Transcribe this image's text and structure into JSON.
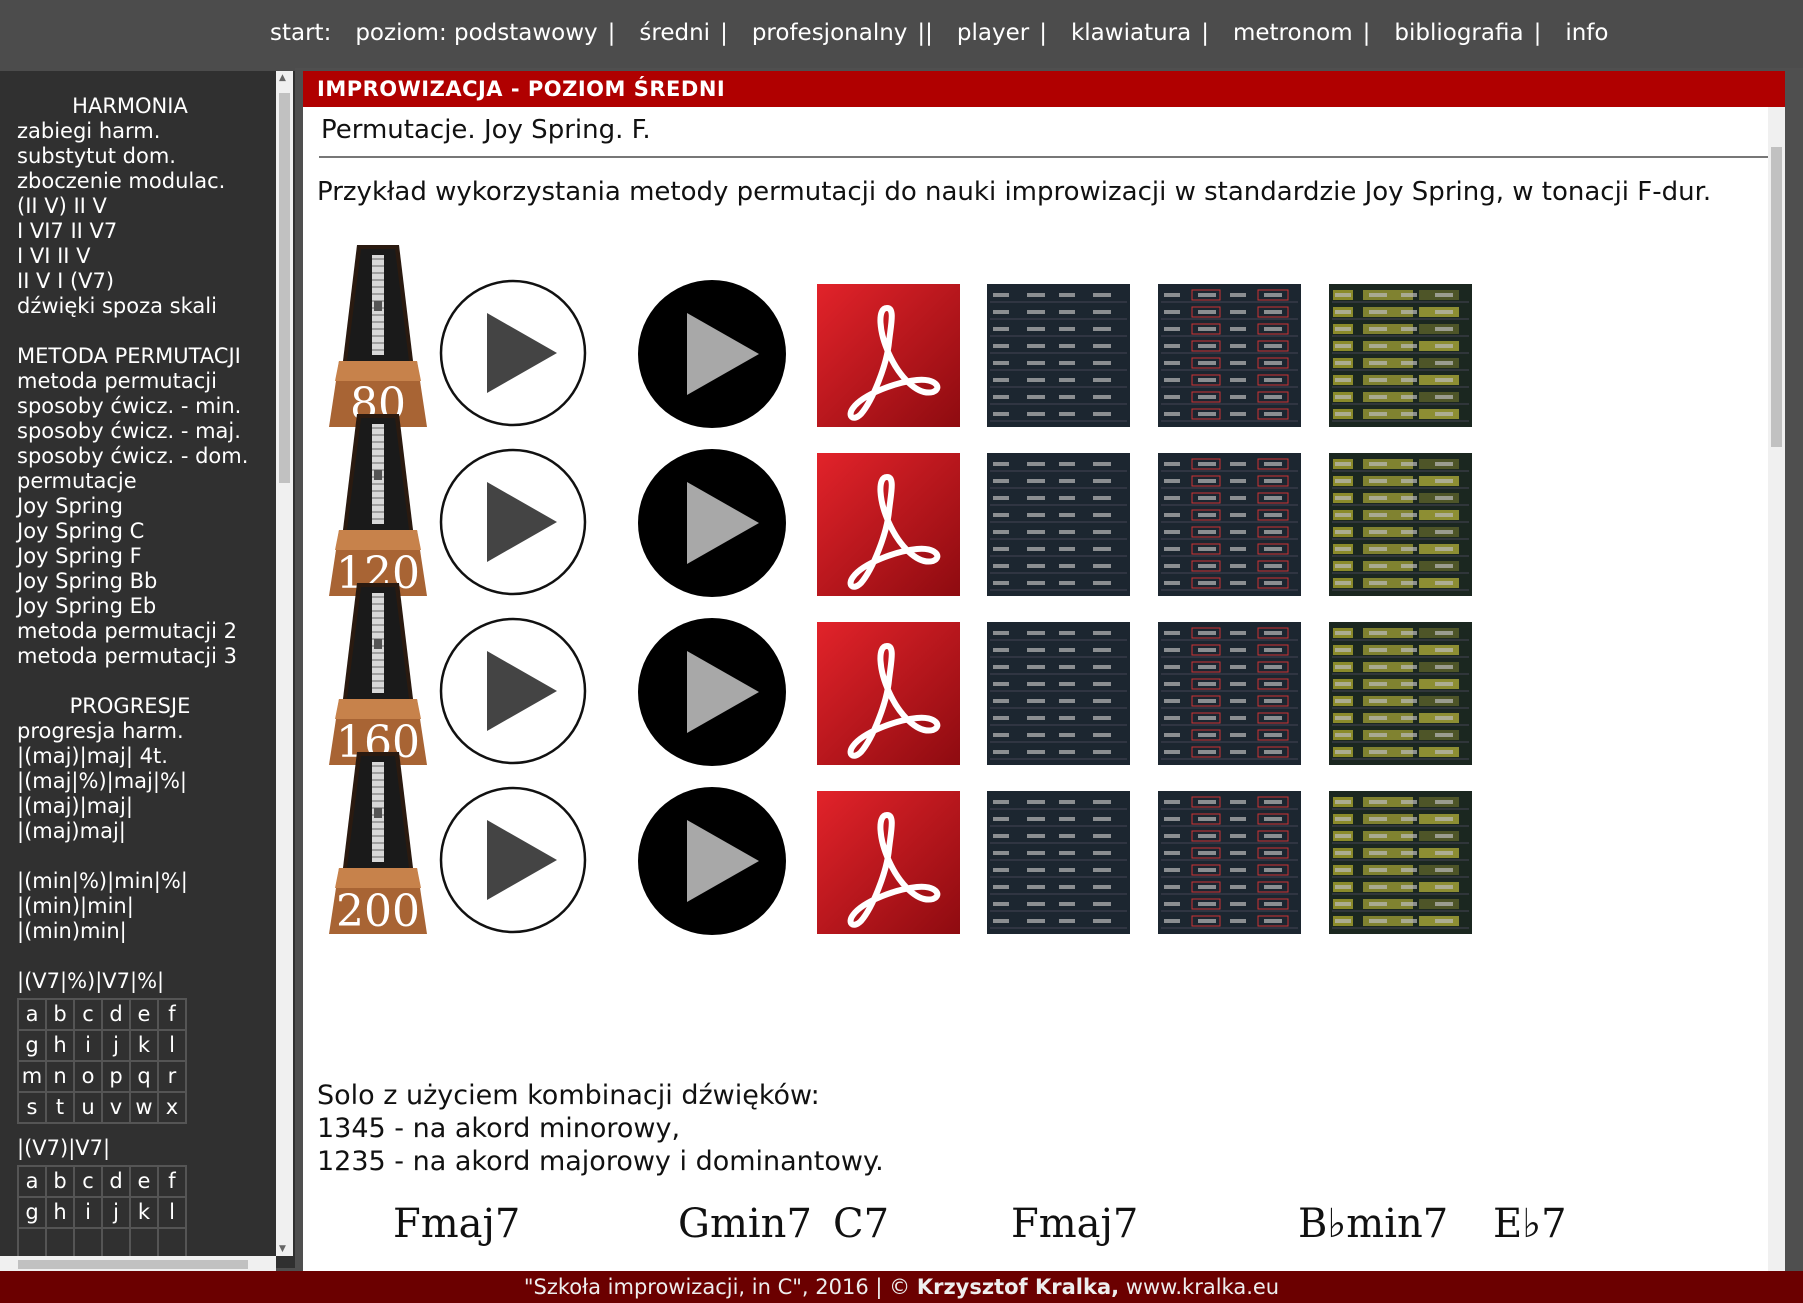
{
  "topnav": {
    "start": "start:",
    "items": [
      {
        "label": "poziom: podstawowy",
        "sep": "|"
      },
      {
        "label": "średni",
        "sep": "|"
      },
      {
        "label": "profesjonalny",
        "sep": "||"
      },
      {
        "label": "player",
        "sep": "|"
      },
      {
        "label": "klawiatura",
        "sep": "|"
      },
      {
        "label": "metronom",
        "sep": "|"
      },
      {
        "label": "bibliografia",
        "sep": "|"
      },
      {
        "label": "info",
        "sep": ""
      }
    ]
  },
  "sidebar": {
    "harmonia_title": "HARMONIA",
    "harmonia": [
      "zabiegi harm.",
      "substytut dom.",
      "zboczenie modulac.",
      "(II V) II V",
      "I VI7 II V7",
      "I VI II V",
      "II V I (V7)",
      "dźwięki spoza skali"
    ],
    "metoda_title": "METODA PERMUTACJI",
    "metoda": [
      "metoda permutacji",
      "sposoby ćwicz. - min.",
      "sposoby ćwicz. - maj.",
      "sposoby ćwicz. - dom.",
      "permutacje",
      "Joy Spring",
      "Joy Spring C",
      "Joy Spring F",
      "Joy Spring Bb",
      "Joy Spring Eb",
      "metoda permutacji 2",
      "metoda permutacji 3"
    ],
    "progresje_title": "PROGRESJE",
    "progresje_a": [
      "progresja harm.",
      "|(maj)|maj| 4t.",
      "|(maj|%)|maj|%|",
      "|(maj)|maj|",
      "|(maj)maj|"
    ],
    "progresje_b": [
      "|(min|%)|min|%|",
      "|(min)|min|",
      "|(min)min|"
    ],
    "v7_title": "|(V7|%)|V7|%|",
    "v7_grid": [
      [
        "a",
        "b",
        "c",
        "d",
        "e",
        "f"
      ],
      [
        "g",
        "h",
        "i",
        "j",
        "k",
        "l"
      ],
      [
        "m",
        "n",
        "o",
        "p",
        "q",
        "r"
      ],
      [
        "s",
        "t",
        "u",
        "v",
        "w",
        "x"
      ]
    ],
    "v7b_title": "|(V7)|V7|",
    "v7b_grid": [
      [
        "a",
        "b",
        "c",
        "d",
        "e",
        "f"
      ],
      [
        "g",
        "h",
        "i",
        "j",
        "k",
        "l"
      ],
      [
        "",
        "",
        "",
        "",
        "",
        ""
      ]
    ]
  },
  "main": {
    "bar_title": "IMPROWIZACJA - POZIOM ŚREDNI",
    "subtitle": "Permutacje. Joy Spring. F.",
    "intro": "Przykład wykorzystania metody permutacji do nauki improwizacji w standardzie Joy Spring, w tonacji F-dur.",
    "tempos": [
      "80",
      "120",
      "160",
      "200"
    ],
    "solo_lines": [
      "Solo z użyciem kombinacji dźwięków:",
      "1345 - na akord minorowy,",
      "1235 - na akord majorowy i dominantowy."
    ],
    "chords": [
      "Fmaj7",
      "Gmin7",
      "C7",
      "Fmaj7",
      "B♭min7",
      "E♭7"
    ]
  },
  "footer": {
    "text_prefix": "\"Szkoła improwizacji, in C\", 2016 | © ",
    "author": "Krzysztof Kralka,",
    "site": " www.kralka.eu"
  },
  "colors": {
    "bar_red": "#b00000",
    "footer_red": "#6b0000",
    "sidebar_bg": "#303030",
    "nav_bg": "#4c4c4c"
  },
  "icons": [
    "metronome-icon",
    "play-light-icon",
    "play-dark-icon",
    "pdf-icon",
    "score-thumbnail-icon"
  ]
}
